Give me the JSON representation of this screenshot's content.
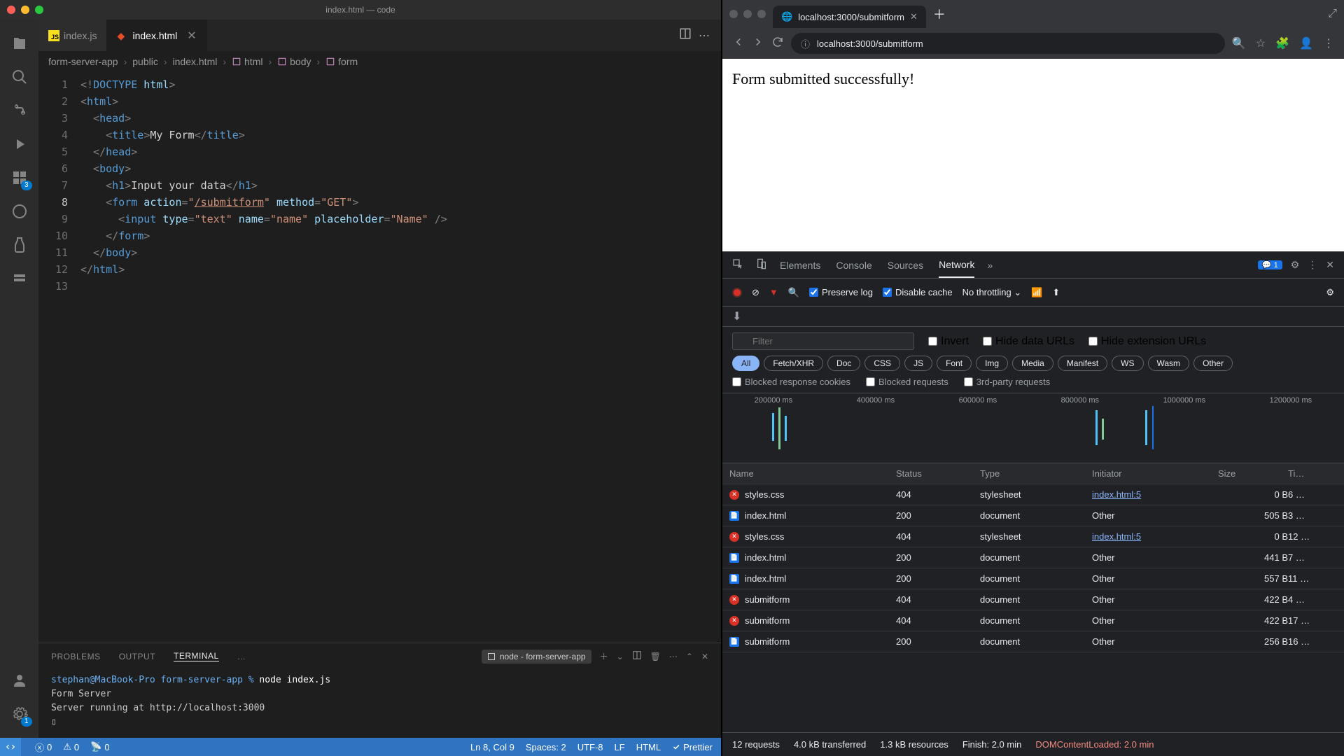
{
  "vscode": {
    "title": "index.html — code",
    "activity_badges": {
      "ext_count": "3",
      "settings_count": "1"
    },
    "tabs": [
      {
        "icon": "js",
        "label": "index.js",
        "active": false
      },
      {
        "icon": "html",
        "label": "index.html",
        "active": true
      }
    ],
    "breadcrumbs": [
      "form-server-app",
      "public",
      "index.html",
      "html",
      "body",
      "form"
    ],
    "code": [
      {
        "n": 1,
        "segs": [
          [
            "<!",
            "c-gray"
          ],
          [
            "DOCTYPE",
            "c-doctype"
          ],
          [
            " html",
            "c-attr"
          ],
          [
            ">",
            "c-gray"
          ]
        ]
      },
      {
        "n": 2,
        "segs": [
          [
            "<",
            "c-gray"
          ],
          [
            "html",
            "c-tag"
          ],
          [
            ">",
            "c-gray"
          ]
        ]
      },
      {
        "n": 3,
        "segs": [
          [
            "  <",
            "c-gray"
          ],
          [
            "head",
            "c-tag"
          ],
          [
            ">",
            "c-gray"
          ]
        ]
      },
      {
        "n": 4,
        "segs": [
          [
            "    <",
            "c-gray"
          ],
          [
            "title",
            "c-tag"
          ],
          [
            ">",
            "c-gray"
          ],
          [
            "My Form",
            "c-txt"
          ],
          [
            "</",
            "c-gray"
          ],
          [
            "title",
            "c-tag"
          ],
          [
            ">",
            "c-gray"
          ]
        ]
      },
      {
        "n": 5,
        "segs": [
          [
            "  </",
            "c-gray"
          ],
          [
            "head",
            "c-tag"
          ],
          [
            ">",
            "c-gray"
          ]
        ]
      },
      {
        "n": 6,
        "segs": [
          [
            "  <",
            "c-gray"
          ],
          [
            "body",
            "c-tag"
          ],
          [
            ">",
            "c-gray"
          ]
        ]
      },
      {
        "n": 7,
        "segs": [
          [
            "    <",
            "c-gray"
          ],
          [
            "h1",
            "c-tag"
          ],
          [
            ">",
            "c-gray"
          ],
          [
            "Input your data",
            "c-txt"
          ],
          [
            "</",
            "c-gray"
          ],
          [
            "h1",
            "c-tag"
          ],
          [
            ">",
            "c-gray"
          ]
        ]
      },
      {
        "n": 8,
        "current": true,
        "segs": [
          [
            "    <",
            "c-gray"
          ],
          [
            "form",
            "c-tag"
          ],
          [
            " action",
            "c-attr"
          ],
          [
            "=",
            "c-gray"
          ],
          [
            "\"",
            "c-str"
          ],
          [
            "/submitform",
            "c-str c-link"
          ],
          [
            "\"",
            "c-str"
          ],
          [
            " method",
            "c-attr"
          ],
          [
            "=",
            "c-gray"
          ],
          [
            "\"GET\"",
            "c-str"
          ],
          [
            ">",
            "c-gray"
          ]
        ]
      },
      {
        "n": 9,
        "segs": [
          [
            "      <",
            "c-gray"
          ],
          [
            "input",
            "c-tag"
          ],
          [
            " type",
            "c-attr"
          ],
          [
            "=",
            "c-gray"
          ],
          [
            "\"text\"",
            "c-str"
          ],
          [
            " name",
            "c-attr"
          ],
          [
            "=",
            "c-gray"
          ],
          [
            "\"name\"",
            "c-str"
          ],
          [
            " placeholder",
            "c-attr"
          ],
          [
            "=",
            "c-gray"
          ],
          [
            "\"Name\"",
            "c-str"
          ],
          [
            " />",
            "c-gray"
          ]
        ]
      },
      {
        "n": 10,
        "segs": [
          [
            "    </",
            "c-gray"
          ],
          [
            "form",
            "c-tag"
          ],
          [
            ">",
            "c-gray"
          ]
        ]
      },
      {
        "n": 11,
        "segs": [
          [
            "  </",
            "c-gray"
          ],
          [
            "body",
            "c-tag"
          ],
          [
            ">",
            "c-gray"
          ]
        ]
      },
      {
        "n": 12,
        "segs": [
          [
            "</",
            "c-gray"
          ],
          [
            "html",
            "c-tag"
          ],
          [
            ">",
            "c-gray"
          ]
        ]
      },
      {
        "n": 13,
        "segs": [
          [
            "",
            ""
          ]
        ]
      }
    ],
    "panel_tabs": [
      "PROBLEMS",
      "OUTPUT",
      "TERMINAL",
      "…"
    ],
    "panel_active": 2,
    "terminal_profile": "node - form-server-app",
    "terminal_lines": [
      {
        "prompt": "stephan@MacBook-Pro form-server-app % ",
        "cmd": "node index.js"
      },
      {
        "text": "Form Server"
      },
      {
        "text": "Server running at http://localhost:3000"
      },
      {
        "text": "▯"
      }
    ],
    "status": {
      "errors": "0",
      "warnings": "0",
      "ports": "0",
      "cursor": "Ln 8, Col 9",
      "spaces": "Spaces: 2",
      "encoding": "UTF-8",
      "eol": "LF",
      "lang": "HTML",
      "prettier": "Prettier"
    }
  },
  "browser": {
    "tab_title": "localhost:3000/submitform",
    "url": "localhost:3000/submitform",
    "page_text": "Form submitted successfully!",
    "devtools": {
      "tabs": [
        "Elements",
        "Console",
        "Sources",
        "Network"
      ],
      "active_tab": 3,
      "issues_count": "1",
      "preserve_log": "Preserve log",
      "disable_cache": "Disable cache",
      "throttling": "No throttling",
      "filter_placeholder": "Filter",
      "invert": "Invert",
      "hide_data": "Hide data URLs",
      "hide_ext": "Hide extension URLs",
      "type_pills": [
        "All",
        "Fetch/XHR",
        "Doc",
        "CSS",
        "JS",
        "Font",
        "Img",
        "Media",
        "Manifest",
        "WS",
        "Wasm",
        "Other"
      ],
      "blocked_resp": "Blocked response cookies",
      "blocked_req": "Blocked requests",
      "third_party": "3rd-party requests",
      "ticks": [
        "200000 ms",
        "400000 ms",
        "600000 ms",
        "800000 ms",
        "1000000 ms",
        "1200000 ms"
      ],
      "columns": [
        "Name",
        "Status",
        "Type",
        "Initiator",
        "Size",
        "Ti…"
      ],
      "rows": [
        {
          "err": true,
          "name": "styles.css",
          "status": "404",
          "type": "stylesheet",
          "initiator": "index.html:5",
          "link": true,
          "size": "0 B",
          "time": "6 …"
        },
        {
          "err": false,
          "name": "index.html",
          "status": "200",
          "type": "document",
          "initiator": "Other",
          "link": false,
          "size": "505 B",
          "time": "3 …"
        },
        {
          "err": true,
          "name": "styles.css",
          "status": "404",
          "type": "stylesheet",
          "initiator": "index.html:5",
          "link": true,
          "size": "0 B",
          "time": "12 …"
        },
        {
          "err": false,
          "name": "index.html",
          "status": "200",
          "type": "document",
          "initiator": "Other",
          "link": false,
          "size": "441 B",
          "time": "7 …"
        },
        {
          "err": false,
          "name": "index.html",
          "status": "200",
          "type": "document",
          "initiator": "Other",
          "link": false,
          "size": "557 B",
          "time": "11 …"
        },
        {
          "err": true,
          "name": "submitform",
          "status": "404",
          "type": "document",
          "initiator": "Other",
          "link": false,
          "size": "422 B",
          "time": "4 …"
        },
        {
          "err": true,
          "name": "submitform",
          "status": "404",
          "type": "document",
          "initiator": "Other",
          "link": false,
          "size": "422 B",
          "time": "17 …"
        },
        {
          "err": false,
          "name": "submitform",
          "status": "200",
          "type": "document",
          "initiator": "Other",
          "link": false,
          "size": "256 B",
          "time": "16 …"
        }
      ],
      "status_summary": {
        "requests": "12 requests",
        "transferred": "4.0 kB transferred",
        "resources": "1.3 kB resources",
        "finish": "Finish: 2.0 min",
        "dom": "DOMContentLoaded: 2.0 min"
      }
    }
  }
}
